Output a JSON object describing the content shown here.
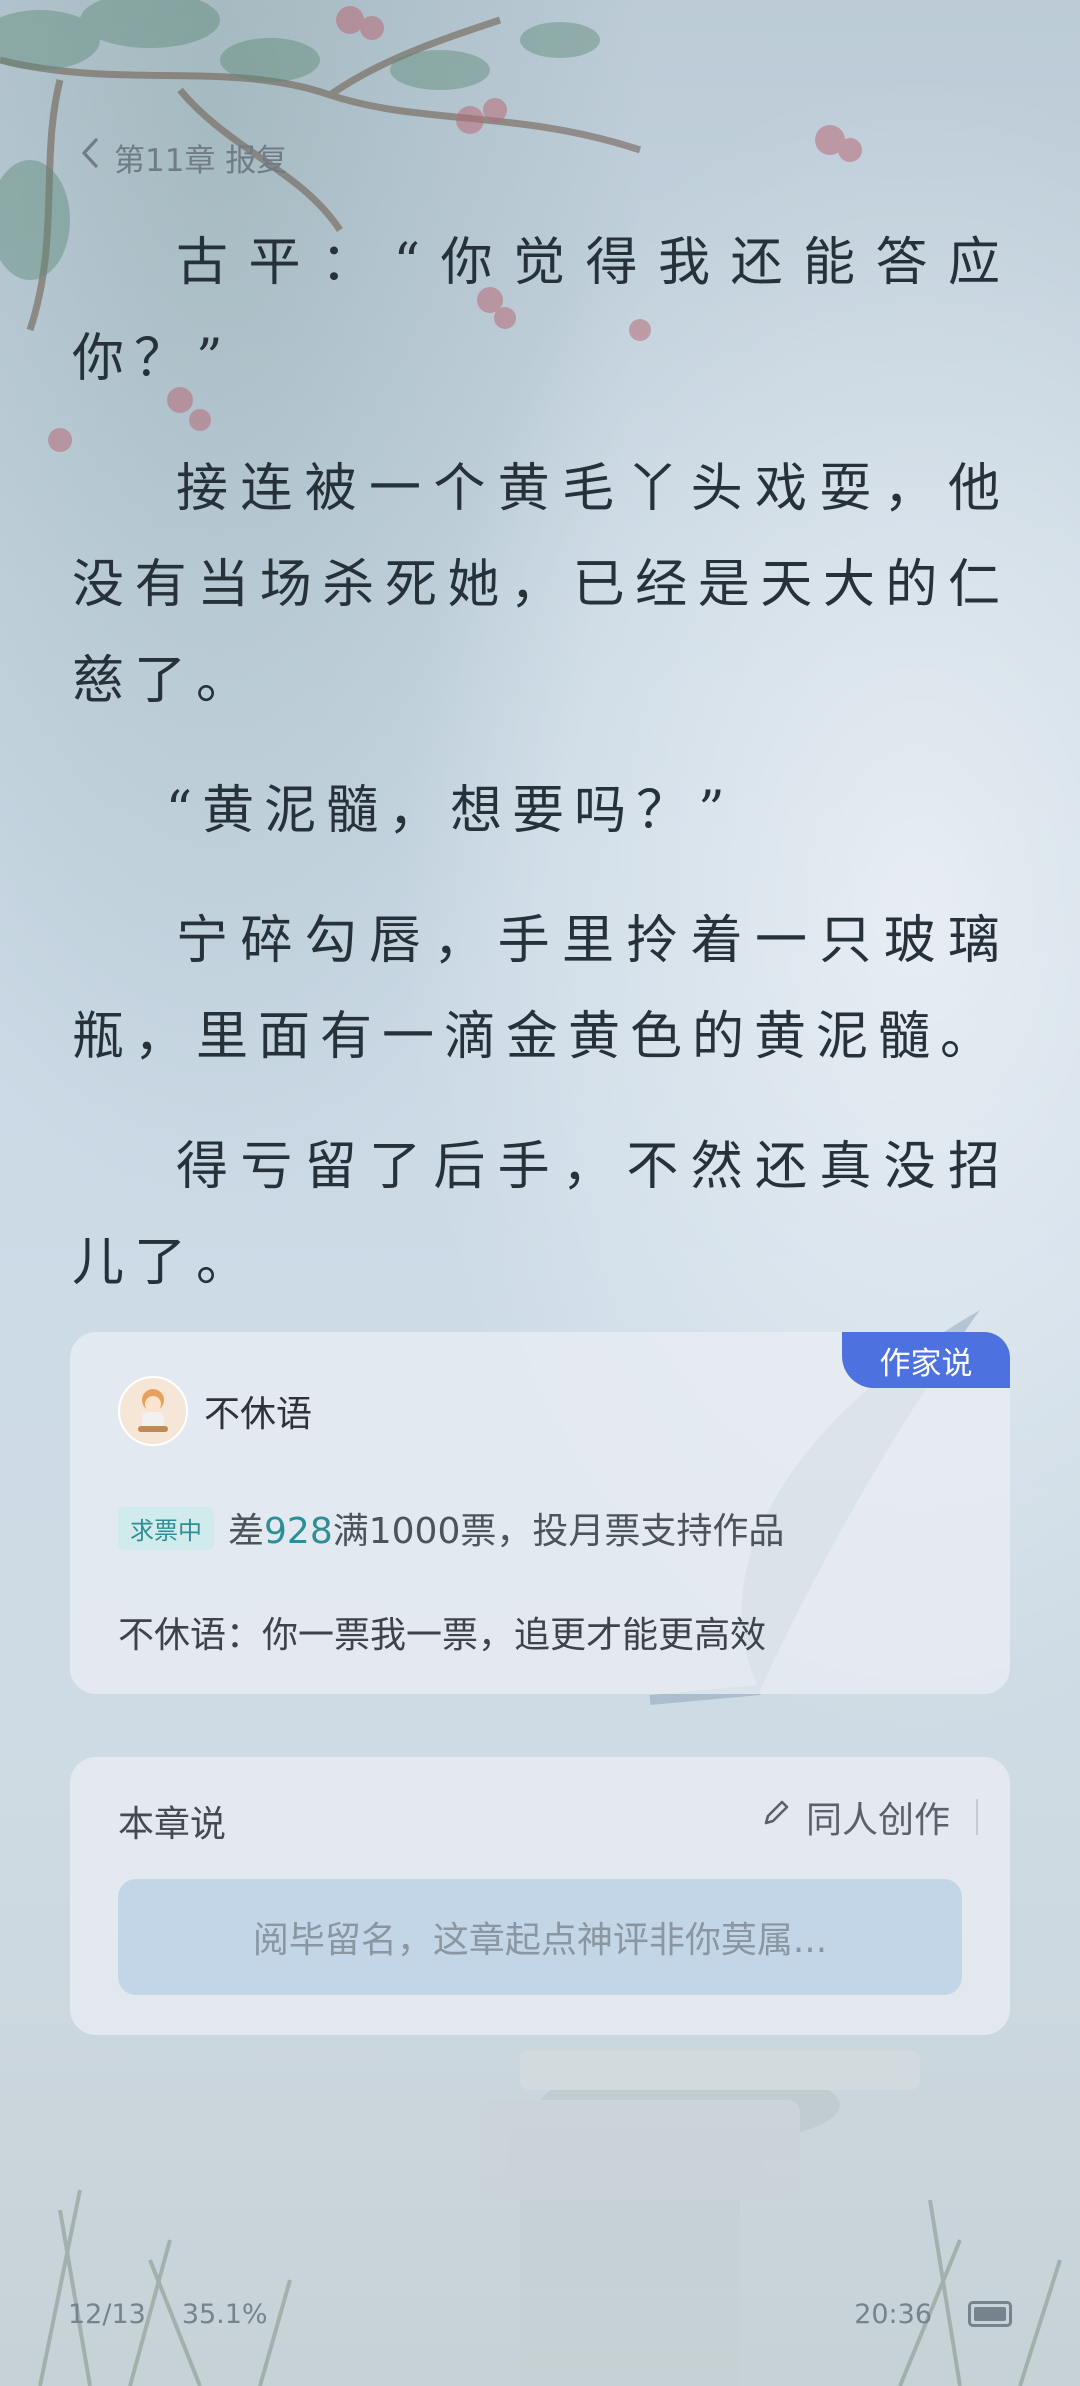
{
  "header": {
    "back_icon": "chevron-left-icon",
    "chapter_title": "第11章 报复"
  },
  "story": {
    "paragraphs": [
      "古平：“你觉得我还能答应你？”",
      "接连被一个黄毛丫头戏耍，他没有当场杀死她，已经是天大的仁慈了。",
      "“黄泥髓，想要吗？”",
      "宁碎勾唇，手里拎着一只玻璃瓶，里面有一滴金黄色的黄泥髓。",
      "得亏留了后手，不然还真没招儿了。"
    ]
  },
  "author_card": {
    "tag": "作家说",
    "author_name": "不休语",
    "vote_badge": "求票中",
    "vote_prefix": "差",
    "vote_number": "928",
    "vote_suffix": "满1000票，投月票支持作品",
    "message": "不休语：你一票我一票，追更才能更高效"
  },
  "chapter_card": {
    "title": "本章说",
    "fanfic_icon": "pencil-icon",
    "fanfic_label": "同人创作",
    "comment_placeholder": "阅毕留名，这章起点神评非你莫属..."
  },
  "footer": {
    "page": "12/13",
    "progress": "35.1%",
    "time": "20:36",
    "battery_icon": "battery-icon"
  },
  "colors": {
    "author_tag": "#4d72e0",
    "vote_accent": "#2d8f96",
    "comment_input": "#c3d6e7"
  }
}
